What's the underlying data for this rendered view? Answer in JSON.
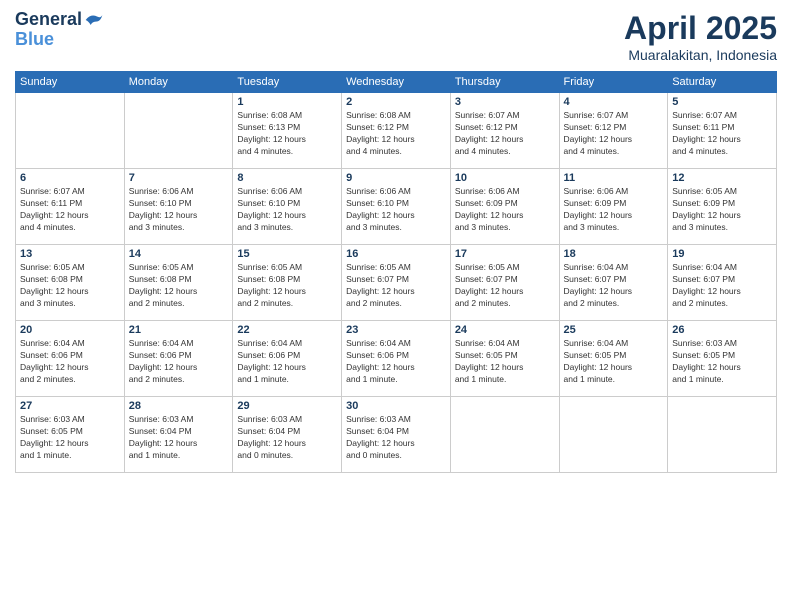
{
  "logo": {
    "line1": "General",
    "line2": "Blue"
  },
  "title": {
    "month_year": "April 2025",
    "location": "Muaralakitan, Indonesia"
  },
  "days_of_week": [
    "Sunday",
    "Monday",
    "Tuesday",
    "Wednesday",
    "Thursday",
    "Friday",
    "Saturday"
  ],
  "weeks": [
    [
      {
        "day": "",
        "info": ""
      },
      {
        "day": "",
        "info": ""
      },
      {
        "day": "1",
        "info": "Sunrise: 6:08 AM\nSunset: 6:13 PM\nDaylight: 12 hours\nand 4 minutes."
      },
      {
        "day": "2",
        "info": "Sunrise: 6:08 AM\nSunset: 6:12 PM\nDaylight: 12 hours\nand 4 minutes."
      },
      {
        "day": "3",
        "info": "Sunrise: 6:07 AM\nSunset: 6:12 PM\nDaylight: 12 hours\nand 4 minutes."
      },
      {
        "day": "4",
        "info": "Sunrise: 6:07 AM\nSunset: 6:12 PM\nDaylight: 12 hours\nand 4 minutes."
      },
      {
        "day": "5",
        "info": "Sunrise: 6:07 AM\nSunset: 6:11 PM\nDaylight: 12 hours\nand 4 minutes."
      }
    ],
    [
      {
        "day": "6",
        "info": "Sunrise: 6:07 AM\nSunset: 6:11 PM\nDaylight: 12 hours\nand 4 minutes."
      },
      {
        "day": "7",
        "info": "Sunrise: 6:06 AM\nSunset: 6:10 PM\nDaylight: 12 hours\nand 3 minutes."
      },
      {
        "day": "8",
        "info": "Sunrise: 6:06 AM\nSunset: 6:10 PM\nDaylight: 12 hours\nand 3 minutes."
      },
      {
        "day": "9",
        "info": "Sunrise: 6:06 AM\nSunset: 6:10 PM\nDaylight: 12 hours\nand 3 minutes."
      },
      {
        "day": "10",
        "info": "Sunrise: 6:06 AM\nSunset: 6:09 PM\nDaylight: 12 hours\nand 3 minutes."
      },
      {
        "day": "11",
        "info": "Sunrise: 6:06 AM\nSunset: 6:09 PM\nDaylight: 12 hours\nand 3 minutes."
      },
      {
        "day": "12",
        "info": "Sunrise: 6:05 AM\nSunset: 6:09 PM\nDaylight: 12 hours\nand 3 minutes."
      }
    ],
    [
      {
        "day": "13",
        "info": "Sunrise: 6:05 AM\nSunset: 6:08 PM\nDaylight: 12 hours\nand 3 minutes."
      },
      {
        "day": "14",
        "info": "Sunrise: 6:05 AM\nSunset: 6:08 PM\nDaylight: 12 hours\nand 2 minutes."
      },
      {
        "day": "15",
        "info": "Sunrise: 6:05 AM\nSunset: 6:08 PM\nDaylight: 12 hours\nand 2 minutes."
      },
      {
        "day": "16",
        "info": "Sunrise: 6:05 AM\nSunset: 6:07 PM\nDaylight: 12 hours\nand 2 minutes."
      },
      {
        "day": "17",
        "info": "Sunrise: 6:05 AM\nSunset: 6:07 PM\nDaylight: 12 hours\nand 2 minutes."
      },
      {
        "day": "18",
        "info": "Sunrise: 6:04 AM\nSunset: 6:07 PM\nDaylight: 12 hours\nand 2 minutes."
      },
      {
        "day": "19",
        "info": "Sunrise: 6:04 AM\nSunset: 6:07 PM\nDaylight: 12 hours\nand 2 minutes."
      }
    ],
    [
      {
        "day": "20",
        "info": "Sunrise: 6:04 AM\nSunset: 6:06 PM\nDaylight: 12 hours\nand 2 minutes."
      },
      {
        "day": "21",
        "info": "Sunrise: 6:04 AM\nSunset: 6:06 PM\nDaylight: 12 hours\nand 2 minutes."
      },
      {
        "day": "22",
        "info": "Sunrise: 6:04 AM\nSunset: 6:06 PM\nDaylight: 12 hours\nand 1 minute."
      },
      {
        "day": "23",
        "info": "Sunrise: 6:04 AM\nSunset: 6:06 PM\nDaylight: 12 hours\nand 1 minute."
      },
      {
        "day": "24",
        "info": "Sunrise: 6:04 AM\nSunset: 6:05 PM\nDaylight: 12 hours\nand 1 minute."
      },
      {
        "day": "25",
        "info": "Sunrise: 6:04 AM\nSunset: 6:05 PM\nDaylight: 12 hours\nand 1 minute."
      },
      {
        "day": "26",
        "info": "Sunrise: 6:03 AM\nSunset: 6:05 PM\nDaylight: 12 hours\nand 1 minute."
      }
    ],
    [
      {
        "day": "27",
        "info": "Sunrise: 6:03 AM\nSunset: 6:05 PM\nDaylight: 12 hours\nand 1 minute."
      },
      {
        "day": "28",
        "info": "Sunrise: 6:03 AM\nSunset: 6:04 PM\nDaylight: 12 hours\nand 1 minute."
      },
      {
        "day": "29",
        "info": "Sunrise: 6:03 AM\nSunset: 6:04 PM\nDaylight: 12 hours\nand 0 minutes."
      },
      {
        "day": "30",
        "info": "Sunrise: 6:03 AM\nSunset: 6:04 PM\nDaylight: 12 hours\nand 0 minutes."
      },
      {
        "day": "",
        "info": ""
      },
      {
        "day": "",
        "info": ""
      },
      {
        "day": "",
        "info": ""
      }
    ]
  ]
}
